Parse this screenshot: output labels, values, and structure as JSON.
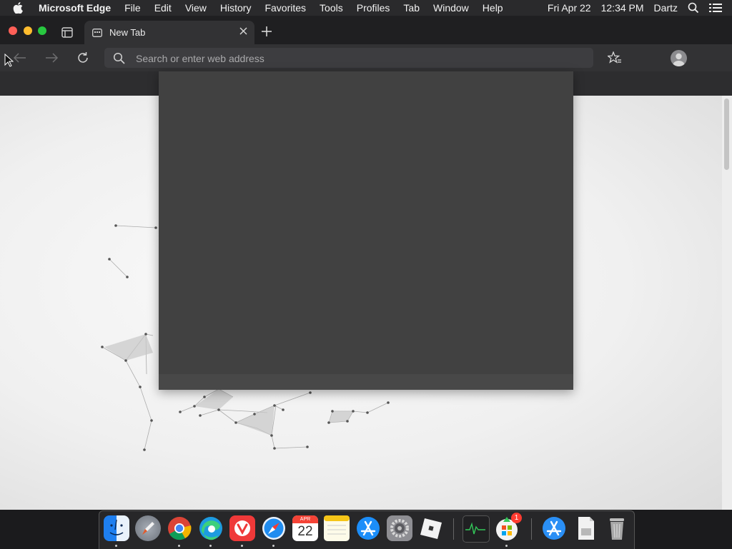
{
  "menubar": {
    "app_name": "Microsoft Edge",
    "menus": [
      "File",
      "Edit",
      "View",
      "History",
      "Favorites",
      "Tools",
      "Profiles",
      "Tab",
      "Window",
      "Help"
    ],
    "date": "Fri Apr 22",
    "time": "12:34 PM",
    "user": "Dartz"
  },
  "browser": {
    "tab_title": "New Tab",
    "address_placeholder": "Search or enter web address",
    "address_value": ""
  },
  "dock": {
    "items": [
      {
        "name": "Finder",
        "icon": "finder-icon",
        "running": true
      },
      {
        "name": "Launchpad",
        "icon": "launchpad-icon",
        "running": false
      },
      {
        "name": "Google Chrome",
        "icon": "chrome-icon",
        "running": true
      },
      {
        "name": "Microsoft Edge",
        "icon": "edge-icon",
        "running": true
      },
      {
        "name": "Vivaldi",
        "icon": "vivaldi-icon",
        "running": true
      },
      {
        "name": "Safari",
        "icon": "safari-icon",
        "running": true
      },
      {
        "name": "Calendar",
        "icon": "calendar-icon",
        "running": false,
        "month": "APR",
        "day": "22"
      },
      {
        "name": "Notes",
        "icon": "notes-icon",
        "running": false
      },
      {
        "name": "App Store",
        "icon": "app-store-icon",
        "running": false
      },
      {
        "name": "System Preferences",
        "icon": "system-preferences-icon",
        "running": false
      },
      {
        "name": "Roblox",
        "icon": "roblox-icon",
        "running": false
      },
      {
        "name": "Activity Monitor",
        "icon": "activity-monitor-icon",
        "running": false
      },
      {
        "name": "Microsoft AutoUpdate",
        "icon": "microsoft-autoupdate-icon",
        "running": true,
        "badge": "1"
      },
      {
        "name": "Applications",
        "icon": "applications-folder-icon",
        "running": false
      },
      {
        "name": "Documents",
        "icon": "document-icon",
        "running": false
      },
      {
        "name": "Trash",
        "icon": "trash-icon",
        "running": false
      }
    ]
  },
  "colors": {
    "traffic_close": "#ff5f57",
    "traffic_minimize": "#febc2e",
    "traffic_zoom": "#28c840",
    "toolbar": "#323234",
    "popup": "#414141"
  }
}
